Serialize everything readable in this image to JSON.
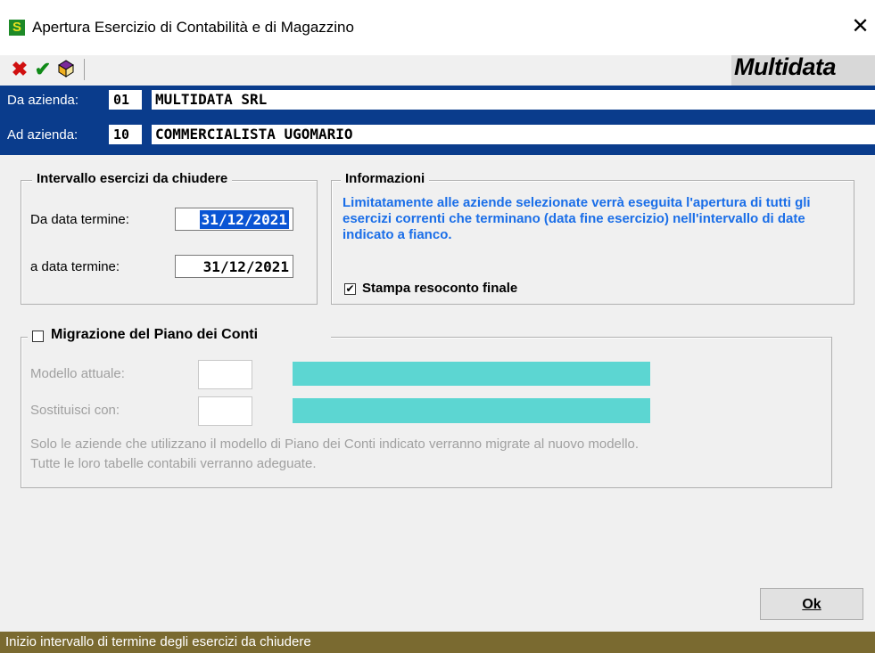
{
  "window": {
    "title": "Apertura Esercizio di Contabilità e di Magazzino",
    "app_icon_letter": "S",
    "close_symbol": "✕"
  },
  "toolbar": {
    "cancel_icon": "✖",
    "confirm_icon": "✔",
    "book_icon": "book-icon",
    "brand": "Multidata",
    "colors": {
      "cancel": "#d01010",
      "confirm": "#108a18"
    }
  },
  "companies": {
    "from_label": "Da azienda:",
    "from_code": "01",
    "from_name": "MULTIDATA SRL",
    "to_label": "Ad azienda:",
    "to_code": "10",
    "to_name": "COMMERCIALISTA UGOMARIO",
    "band_color": "#0a3c8c"
  },
  "interval": {
    "title": "Intervallo esercizi da chiudere",
    "from_label": "Da data termine:",
    "from_value": "31/12/2021",
    "to_label": "a data termine:",
    "to_value": "31/12/2021"
  },
  "info": {
    "title": "Informazioni",
    "text": "Limitatamente alle aziende selezionate verrà eseguita l'apertura di tutti gli esercizi correnti che terminano (data fine esercizio) nell'intervallo di date indicato a fianco.",
    "print_label": "Stampa resoconto finale",
    "print_checked": true,
    "text_color": "#1a6ee8"
  },
  "migration": {
    "title": "Migrazione del Piano dei Conti",
    "checked": false,
    "current_label": "Modello attuale:",
    "replace_label": "Sostituisci con:",
    "note_line1": "Solo le aziende che utilizzano il modello di Piano dei Conti indicato verranno migrate al nuovo modello.",
    "note_line2": "Tutte le loro tabelle contabili verranno adeguate."
  },
  "ok_label": "Ok",
  "status": "Inizio intervallo di termine degli esercizi da chiudere"
}
